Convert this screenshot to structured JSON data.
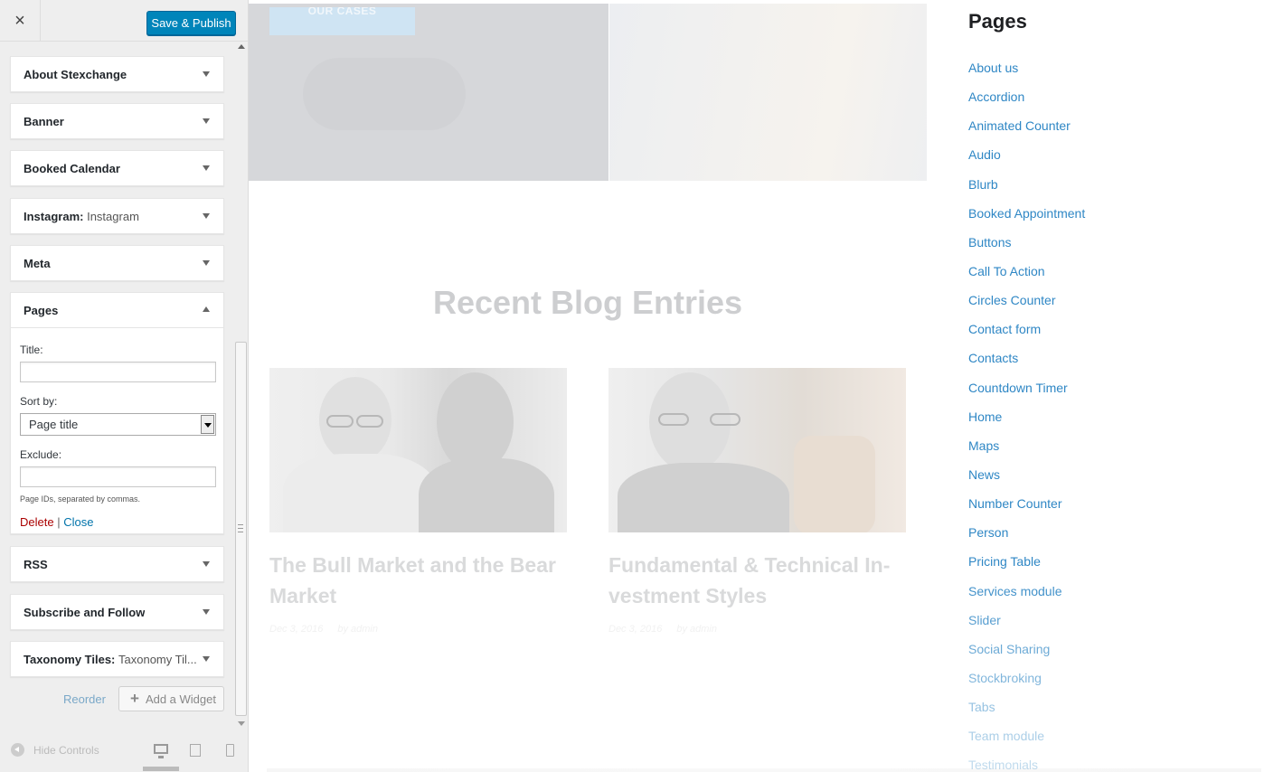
{
  "customizer": {
    "close_label": "×",
    "save_label": "Save & Publish",
    "widgets": [
      {
        "title": "About Stexchange",
        "subtitle": ""
      },
      {
        "title": "Banner",
        "subtitle": ""
      },
      {
        "title": "Booked Calendar",
        "subtitle": ""
      },
      {
        "title": "Instagram:",
        "subtitle": "Instagram"
      },
      {
        "title": "Meta",
        "subtitle": ""
      },
      {
        "title": "Pages",
        "subtitle": ""
      },
      {
        "title": "RSS",
        "subtitle": ""
      },
      {
        "title": "Subscribe and Follow",
        "subtitle": ""
      },
      {
        "title": "Taxonomy Tiles:",
        "subtitle": "Taxonomy Til..."
      }
    ],
    "pages_form": {
      "title_label": "Title:",
      "title_value": "",
      "sortby_label": "Sort by:",
      "sortby_value": "Page title",
      "exclude_label": "Exclude:",
      "exclude_value": "",
      "exclude_description": "Page IDs, separated by commas.",
      "delete_label": "Delete",
      "separator": "|",
      "close_label": "Close"
    },
    "reorder_label": "Reorder",
    "add_widget_label": "Add a Widget",
    "hide_controls_label": "Hide Controls"
  },
  "preview": {
    "hero_button_label": "OUR CASES",
    "blog_heading": "Recent Blog Entries",
    "posts": [
      {
        "title": "The Bull Market and the Bear Market",
        "date": "Dec 3, 2016",
        "author": "by admin"
      },
      {
        "title": "Fundamental & Technical In-vestment Styles",
        "date": "Dec 3, 2016",
        "author": "by admin"
      }
    ],
    "sidebar": {
      "heading": "Pages",
      "items": [
        "About us",
        "Accordion",
        "Animated Counter",
        "Audio",
        "Blurb",
        "Booked Appointment",
        "Buttons",
        "Call To Action",
        "Circles Counter",
        "Contact form",
        "Contacts",
        "Countdown Timer",
        "Home",
        "Maps",
        "News",
        "Number Counter",
        "Person",
        "Pricing Table",
        "Services module",
        "Slider",
        "Social Sharing",
        "Stockbroking",
        "Tabs",
        "Team module",
        "Testimonials"
      ]
    }
  },
  "colors": {
    "accent_blue": "#0085ba",
    "link_blue": "#2f87c5",
    "delete_red": "#aa0000"
  }
}
